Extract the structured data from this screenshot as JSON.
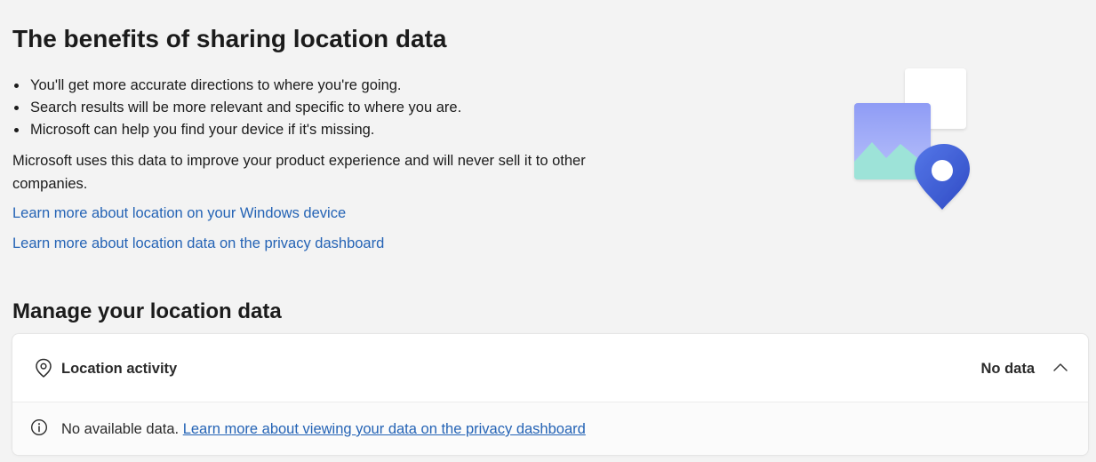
{
  "benefits": {
    "title": "The benefits of sharing location data",
    "bullets": [
      "You'll get more accurate directions to where you're going.",
      "Search results will be more relevant and specific to where you are.",
      "Microsoft can help you find your device if it's missing."
    ],
    "paragraph": "Microsoft uses this data to improve your product experience and will never sell it to other companies.",
    "links": [
      "Learn more about location on your Windows device",
      "Learn more about location data on the privacy dashboard"
    ]
  },
  "illustration": {
    "icon": "photo-with-location-pin-illustration",
    "colors": {
      "back_square": "#ffffff",
      "photo_top": "#8f9cf5",
      "photo_bottom": "#b9c2fb",
      "mountains": "#9de3d8",
      "pin_outer": "#3f5fd6",
      "pin_inner": "#ffffff"
    }
  },
  "manage": {
    "title": "Manage your location data",
    "card": {
      "icon": "location-pin-icon",
      "label": "Location activity",
      "status": "No data",
      "chevron_icon": "chevron-up-icon",
      "info_icon": "info-icon",
      "message": "No available data.",
      "link": "Learn more about viewing your data on the privacy dashboard"
    }
  },
  "colors": {
    "background": "#f3f3f3",
    "link": "#2463b5",
    "text": "#1b1b1b",
    "card": "#ffffff"
  }
}
